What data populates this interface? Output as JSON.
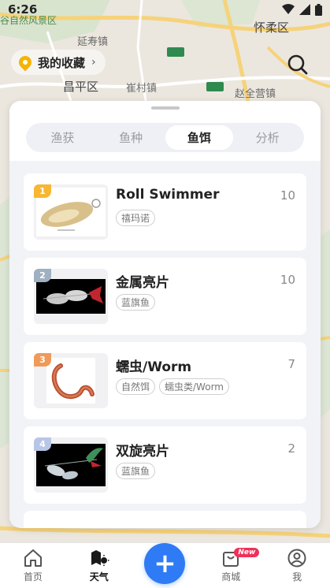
{
  "status_bar": {
    "time": "6:26"
  },
  "map": {
    "labels": {
      "scenic_area": "谷自然风景区",
      "huairou": "怀柔区",
      "yanshou": "延寿镇",
      "changping": "昌平区",
      "cuicun": "崔村镇",
      "zhaoquanying": "赵全营镇",
      "road_tag": "G45",
      "road_tag2": "S26"
    }
  },
  "favorites": {
    "label": "我的收藏",
    "chevron": "›"
  },
  "search": {
    "icon": "search-icon"
  },
  "tabs": [
    {
      "label": "渔获",
      "active": false
    },
    {
      "label": "鱼种",
      "active": false
    },
    {
      "label": "鱼饵",
      "active": true
    },
    {
      "label": "分析",
      "active": false
    }
  ],
  "baits": [
    {
      "rank": "1",
      "rank_color": "#f7b733",
      "name": "Roll Swimmer",
      "count": "10",
      "tags": [
        "禧玛诺"
      ],
      "image": "gold-spoon-lure"
    },
    {
      "rank": "2",
      "rank_color": "#9fb0c0",
      "name": "金属亮片",
      "count": "10",
      "tags": [
        "蓝旗鱼"
      ],
      "image": "metal-spinner-lure"
    },
    {
      "rank": "3",
      "rank_color": "#ef9a5a",
      "name": "蠕虫/Worm",
      "count": "7",
      "tags": [
        "自然饵",
        "蠕虫类/Worm"
      ],
      "image": "worm-bait"
    },
    {
      "rank": "4",
      "rank_color": "#b8c6e6",
      "name": "双旋亮片",
      "count": "2",
      "tags": [
        "蓝旗鱼"
      ],
      "image": "double-spinner-lure"
    }
  ],
  "bottom_nav": {
    "home": "首页",
    "weather": "天气",
    "add": "+",
    "shop": "商城",
    "shop_badge": "New",
    "me": "我"
  },
  "colors": {
    "accent": "#2f7bf5",
    "badge": "#f0305a",
    "sheet_bg": "#f2f3f7"
  }
}
